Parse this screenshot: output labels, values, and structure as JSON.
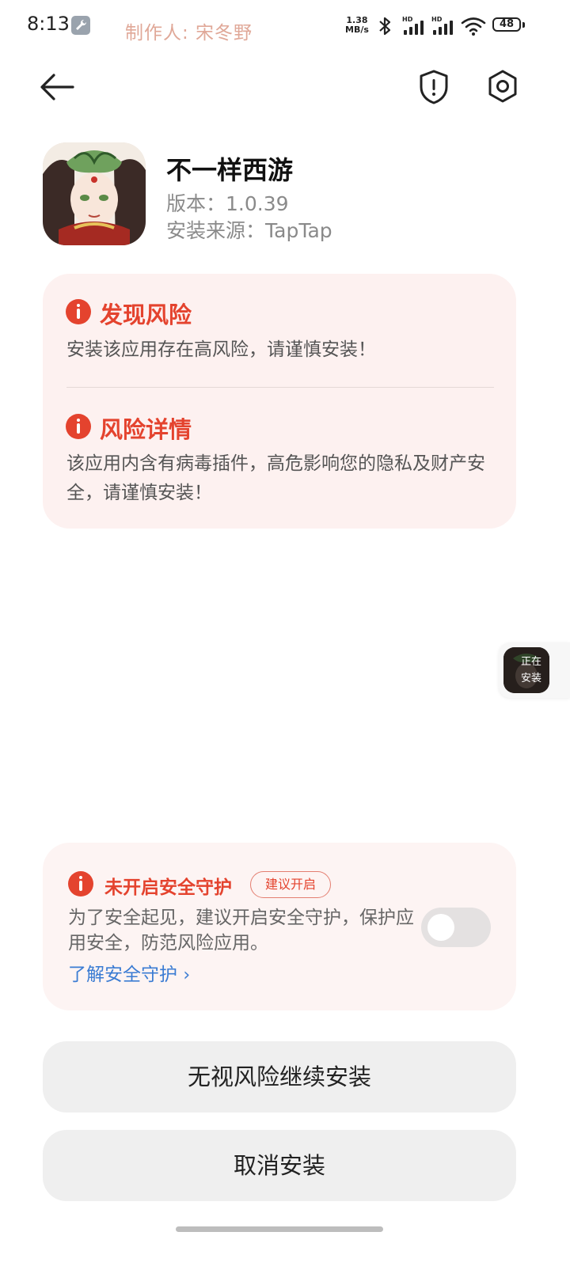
{
  "status_bar": {
    "time": "8:13",
    "watermark": "制作人: 宋冬野",
    "net_speed_value": "1.38",
    "net_speed_unit": "MB/s",
    "signal_label": "HD",
    "battery": "48"
  },
  "app": {
    "name": "不一样西游",
    "version": "版本：1.0.39",
    "source": "安装来源：TapTap"
  },
  "risk": {
    "found_title": "发现风险",
    "found_text": "安装该应用存在高风险，请谨慎安装！",
    "detail_title": "风险详情",
    "detail_text": "该应用内含有病毒插件，高危影响您的隐私及财产安全，请谨慎安装！"
  },
  "floating": {
    "label_line1": "正在",
    "label_line2": "安装"
  },
  "protection": {
    "title": "未开启安全守护",
    "badge": "建议开启",
    "description": "为了安全起见，建议开启安全守护，保护应用安全，防范风险应用。",
    "link": "了解安全守护",
    "toggle_on": false
  },
  "actions": {
    "continue_label": "无视风险继续安装",
    "cancel_label": "取消安装"
  },
  "colors": {
    "danger": "#e4432e",
    "link": "#3b7cd3",
    "card_bg": "#fdf1f0"
  }
}
